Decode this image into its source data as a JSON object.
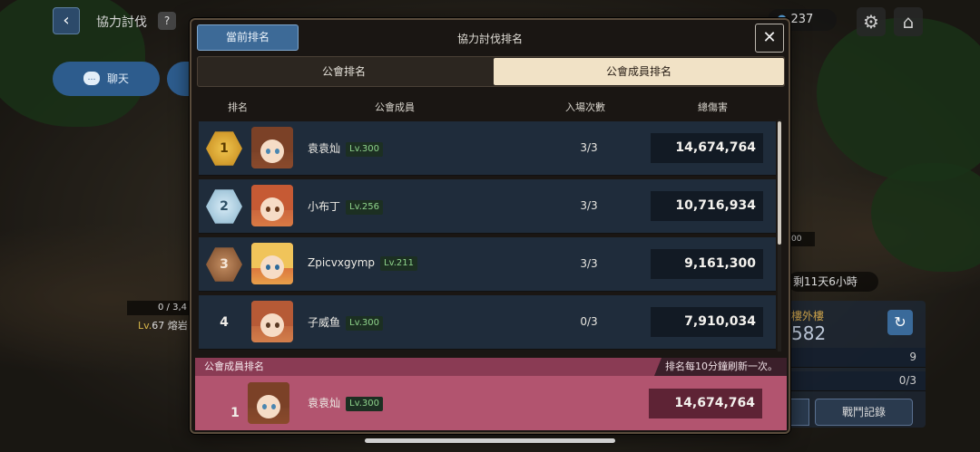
{
  "hud": {
    "title": "協力討伐",
    "help": "?",
    "resource_value": "237",
    "chat_label": "聊天"
  },
  "background_info": {
    "counter": "0 / 3,4",
    "level_prefix": "Lv.",
    "level_value": "67",
    "location": "熔岩",
    "remaining": "剩11天6小時",
    "small_tag": "00",
    "panel_title": "樓外樓",
    "panel_big": "582",
    "panel_row1": "9",
    "panel_row2": "0/3",
    "battle_log": "戰鬥記錄"
  },
  "modal": {
    "current_rank_tab": "當前排名",
    "title": "協力討伐排名",
    "close_symbol": "✕",
    "segments": {
      "guild_rank": "公會排名",
      "member_rank": "公會成員排名"
    },
    "columns": {
      "rank": "排名",
      "member": "公會成員",
      "entries": "入場次數",
      "damage": "總傷害"
    },
    "rows": [
      {
        "rank": "1",
        "name": "袁袁灿",
        "level": "Lv.300",
        "entries": "3/3",
        "damage": "14,674,764"
      },
      {
        "rank": "2",
        "name": "小布丁",
        "level": "Lv.256",
        "entries": "3/3",
        "damage": "10,716,934"
      },
      {
        "rank": "3",
        "name": "Zpicvxgymp",
        "level": "Lv.211",
        "entries": "3/3",
        "damage": "9,161,300"
      },
      {
        "rank": "4",
        "name": "子威鱼",
        "level": "Lv.300",
        "entries": "0/3",
        "damage": "7,910,034"
      }
    ],
    "mine": {
      "header": "公會成員排名",
      "note": "排名每10分鐘刷新一次。",
      "rank": "1",
      "name": "袁袁灿",
      "level": "Lv.300",
      "damage": "14,674,764"
    }
  },
  "colors": {
    "accent_blue": "#3d6a97",
    "gold": "#f0c54e",
    "silver": "#8eb8cf",
    "bronze": "#7d4d2c",
    "my_row": "#b2546f"
  }
}
